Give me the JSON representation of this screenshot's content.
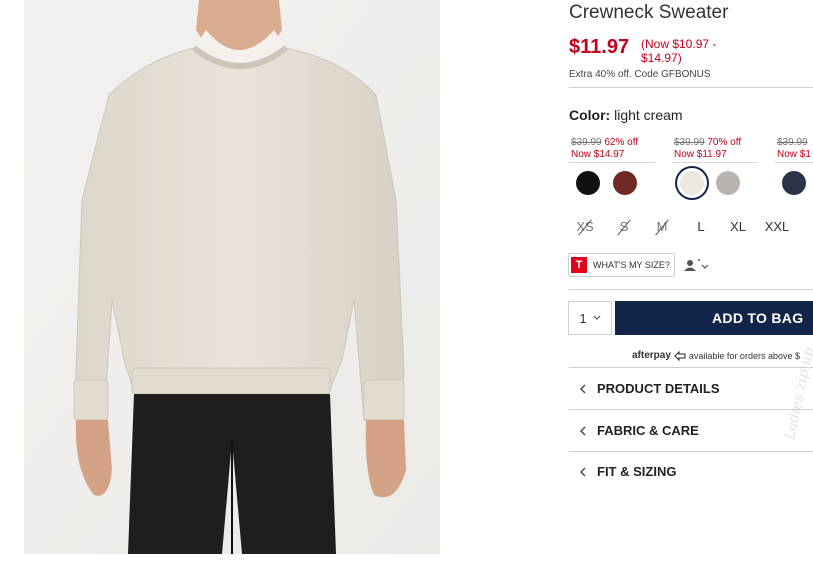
{
  "product": {
    "title": "Crewneck Sweater",
    "price": "$11.97",
    "price_range": "(Now $10.97 - $14.97)",
    "promo": "Extra 40% off. Code GFBONUS",
    "color_label": "Color:",
    "color_value": "light cream"
  },
  "price_groups": [
    {
      "old": "$39.99",
      "off": "62% off",
      "now": "Now $14.97"
    },
    {
      "old": "$39.99",
      "off": "70% off",
      "now": "Now $11.97"
    },
    {
      "old": "$39.99",
      "off": "",
      "now": "Now $1"
    }
  ],
  "swatches": [
    {
      "name": "black",
      "color": "#111111"
    },
    {
      "name": "burgundy",
      "color": "#6e2a22"
    },
    {
      "name": "light cream",
      "color": "#ece8e0",
      "selected": true
    },
    {
      "name": "grey",
      "color": "#b9b4b0"
    },
    {
      "name": "navy",
      "color": "#2b3346"
    }
  ],
  "sizes": [
    {
      "label": "XS",
      "available": false
    },
    {
      "label": "S",
      "available": false
    },
    {
      "label": "M",
      "available": false
    },
    {
      "label": "L",
      "available": true
    },
    {
      "label": "XL",
      "available": true
    },
    {
      "label": "XXL",
      "available": true
    }
  ],
  "fit": {
    "logo": "T",
    "label": "WHAT'S MY SIZE?"
  },
  "cart": {
    "qty": "1",
    "add_label": "ADD TO BAG"
  },
  "afterpay": {
    "name": "afterpay",
    "text": "available for orders above $"
  },
  "accordions": [
    {
      "label": "PRODUCT DETAILS"
    },
    {
      "label": "FABRIC & CARE"
    },
    {
      "label": "FIT & SIZING"
    }
  ],
  "watermark": "Ladies zip.up",
  "colors": {
    "price_red": "#c2001c",
    "navy_button": "#122448",
    "sweater": "#e3ddd2"
  }
}
